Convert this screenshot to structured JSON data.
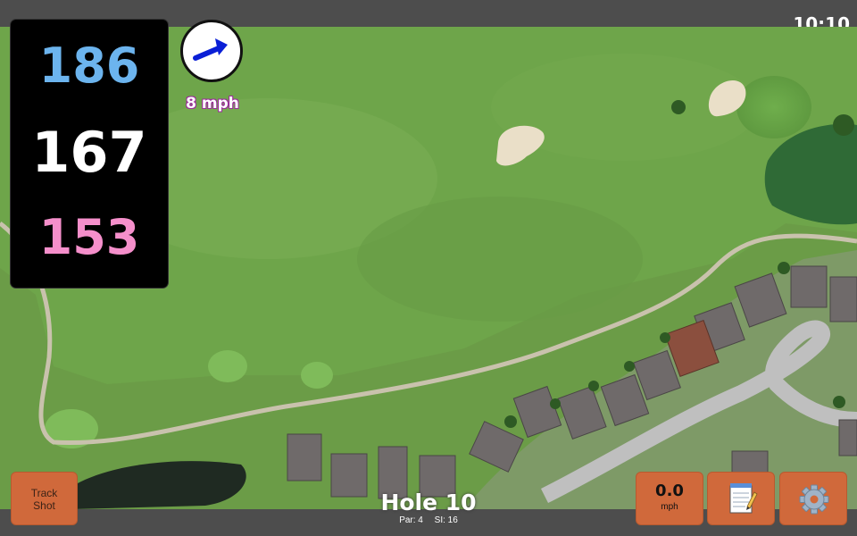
{
  "status_bar": {
    "time": "10:10"
  },
  "yardages": {
    "back": "186",
    "middle": "167",
    "front": "153"
  },
  "wind": {
    "speed_label": "8 mph",
    "direction": "arrow-right-up"
  },
  "buttons": {
    "track_shot_line1": "Track",
    "track_shot_line2": "Shot",
    "speed_value": "0.0",
    "speed_unit": "mph",
    "notes_icon": "notepad-icon",
    "settings_icon": "gear-icon"
  },
  "hole": {
    "title": "Hole 10",
    "par": "Par: 4",
    "stroke_index": "SI: 16"
  },
  "colors": {
    "back_yardage": "#6cb4ee",
    "middle_yardage": "#ffffff",
    "front_yardage": "#f58fcb",
    "button_orange": "#d0693b",
    "fairway_green": "#6a9e45"
  }
}
